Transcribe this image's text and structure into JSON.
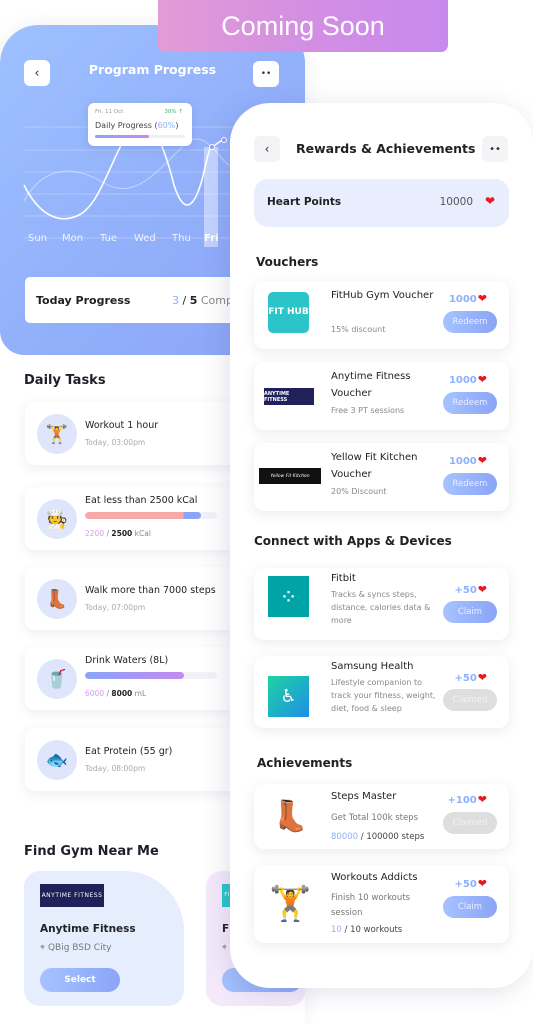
{
  "banner": {
    "label": "Coming Soon"
  },
  "program": {
    "back_icon": "‹",
    "more_icon": "••",
    "title": "Program Progress",
    "tooltip": {
      "date": "Fri, 11 Oct",
      "delta": "30% ↑",
      "title_prefix": "Daily Progress (",
      "percent_text": "60%",
      "title_suffix": ")",
      "progress": 0.6
    },
    "days": [
      "Sun",
      "Mon",
      "Tue",
      "Wed",
      "Thu",
      "Fri"
    ],
    "active_day": "Fri",
    "today": {
      "label": "Today Progress",
      "done": "3",
      "total": "5",
      "suffix": " Comp"
    }
  },
  "daily_tasks": {
    "title": "Daily Tasks",
    "items": [
      {
        "name": "Workout 1 hour",
        "sub": "Today, 03:00pm",
        "icon": "🏋"
      },
      {
        "name": "Eat less than 2500 kCal",
        "current": "2200",
        "total": "2500",
        "unit": "kCal",
        "progress": 0.88,
        "icon": "🧑‍🍳",
        "bar_colors": [
          "#f9a8a8",
          "#8aa4f7"
        ]
      },
      {
        "name": "Walk more than 7000 steps",
        "sub": "Today, 07:00pm",
        "icon": "👢"
      },
      {
        "name": "Drink Waters (8L)",
        "current": "6000",
        "total": "8000",
        "unit": "mL",
        "progress": 0.75,
        "icon": "🥤",
        "bar_colors": [
          "#8aa4f7",
          "#c58af2"
        ]
      },
      {
        "name": "Eat Protein (55 gr)",
        "sub": "Today, 08:00pm",
        "icon": "🐟"
      }
    ]
  },
  "gyms": {
    "title": "Find Gym Near Me",
    "items": [
      {
        "logo": "ANYTIME FITNESS",
        "name": "Anytime Fitness",
        "location": "QBig BSD City",
        "button": "Select"
      },
      {
        "logo": "FIT HUB",
        "name": "Fi",
        "location": "",
        "button": ""
      }
    ]
  },
  "rewards": {
    "back_icon": "‹",
    "more_icon": "••",
    "title": "Rewards & Achievements",
    "heart_points": {
      "label": "Heart Points",
      "value": "10000",
      "icon": "heart"
    },
    "colors": {
      "heart": "#e5191f",
      "accent": "#8bb0ff"
    },
    "vouchers_title": "Vouchers",
    "vouchers": [
      {
        "logo": "FIT HUB",
        "name": "FitHub Gym Voucher",
        "desc": "15% discount",
        "cost": "1000",
        "button": "Redeem"
      },
      {
        "logo": "ANYTIME FITNESS",
        "name": "Anytime Fitness Voucher",
        "desc": "Free 3 PT sessions",
        "cost": "1000",
        "button": "Redeem"
      },
      {
        "logo": "Yellow Fit Kitchen",
        "name": "Yellow Fit Kitchen Voucher",
        "desc": "20% Discount",
        "cost": "1000",
        "button": "Redeem"
      }
    ],
    "apps_title": "Connect with Apps & Devices",
    "apps": [
      {
        "name": "Fitbit",
        "desc": "Tracks & syncs steps, distance, calories data & more",
        "reward": "+50",
        "button": "Claim",
        "claimed": false
      },
      {
        "name": "Samsung Health",
        "desc": "Lifestyle companion to track your fitness, weight, diet, food & sleep",
        "reward": "+50",
        "button": "Claimed",
        "claimed": true
      }
    ],
    "achievements_title": "Achievements",
    "achievements": [
      {
        "name": "Steps Master",
        "desc": "Get Total 100k steps",
        "current": "80000",
        "total_text": " / 100000 steps",
        "reward": "+100",
        "button": "Claimed",
        "claimed": true
      },
      {
        "name": "Workouts Addicts",
        "desc": "Finish 10 workouts session",
        "current": "10",
        "total_text": " / 10 workouts",
        "reward": "+50",
        "button": "Claim",
        "claimed": false
      }
    ]
  }
}
